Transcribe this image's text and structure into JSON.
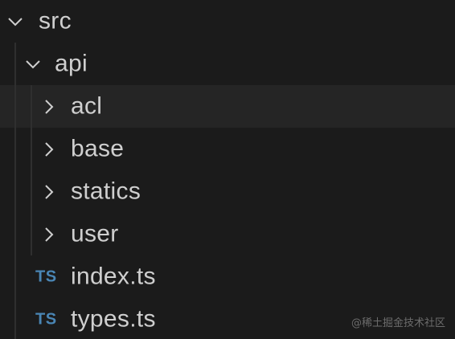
{
  "explorer": {
    "root": {
      "label": "src",
      "icon": "chevron-down-icon",
      "expanded": true
    },
    "api": {
      "label": "api",
      "icon": "chevron-down-icon",
      "expanded": true
    },
    "folders": [
      {
        "label": "acl",
        "icon": "chevron-right-icon",
        "expanded": false
      },
      {
        "label": "base",
        "icon": "chevron-right-icon",
        "expanded": false
      },
      {
        "label": "statics",
        "icon": "chevron-right-icon",
        "expanded": false
      },
      {
        "label": "user",
        "icon": "chevron-right-icon",
        "expanded": false
      }
    ],
    "files": [
      {
        "badge": "TS",
        "label": "index.ts",
        "icon": "typescript-file-icon"
      },
      {
        "badge": "TS",
        "label": "types.ts",
        "icon": "typescript-file-icon"
      }
    ]
  },
  "watermark": "@稀土掘金技术社区",
  "colors": {
    "background": "#1b1b1b",
    "text": "#cfcfcf",
    "ts_badge": "#4a86b5",
    "hover_row": "#252525"
  }
}
